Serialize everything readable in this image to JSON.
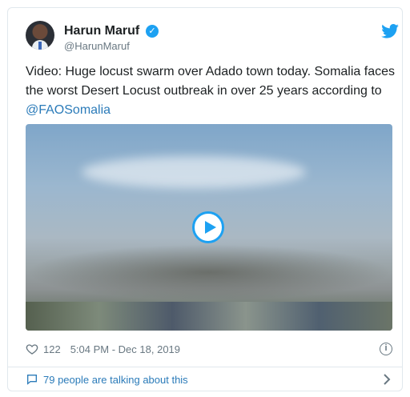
{
  "tweet": {
    "author_name": "Harun Maruf",
    "handle": "@HarunMaruf",
    "text_main": "Video: Huge locust swarm over Adado town today. Somalia faces the worst Desert Locust outbreak in over 25 years  according to ",
    "text_link": "@FAOSomalia",
    "likes": "122",
    "timestamp": "5:04 PM - Dec 18, 2019",
    "talking": "79 people are talking about this"
  },
  "icons": {
    "verified": "verified-badge-icon",
    "logo": "twitter-bird-icon",
    "like": "heart-icon",
    "info": "info-icon",
    "conversation": "speech-bubble-icon",
    "more": "chevron-right-icon",
    "play": "play-icon"
  },
  "colors": {
    "accent": "#1da1f2",
    "link": "#2b7bb9",
    "muted": "#697882",
    "border": "#e1e8ed"
  }
}
